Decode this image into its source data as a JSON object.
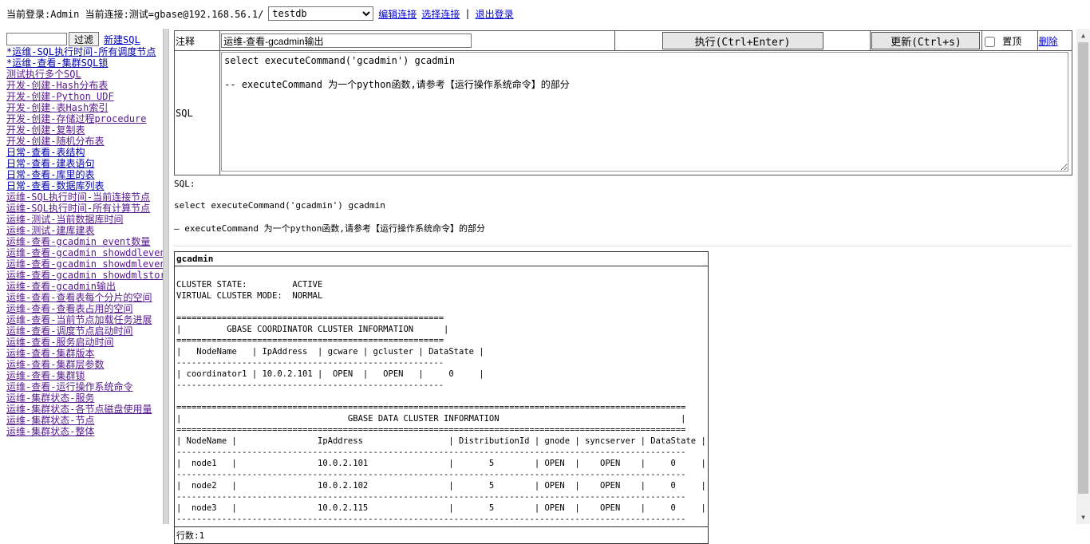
{
  "topbar": {
    "login_text": "当前登录:Admin 当前连接:测试=gbase@192.168.56.1/",
    "db_selected": "testdb",
    "edit_connection": "编辑连接",
    "select_connection": "选择连接",
    "separator": "|",
    "logout": "退出登录"
  },
  "sidebar": {
    "filter_button": "过滤",
    "new_sql": "新建SQL",
    "items": [
      {
        "label": "*运维-SQL执行时间-所有调度节点"
      },
      {
        "label": "*运维-查看-集群SQL锁"
      },
      {
        "label": "测试执行多个SQL"
      },
      {
        "label": "开发-创建-Hash分布表"
      },
      {
        "label": "开发-创建-Python UDF"
      },
      {
        "label": "开发-创建-表Hash索引"
      },
      {
        "label": "开发-创建-存储过程procedure"
      },
      {
        "label": "开发-创建-复制表"
      },
      {
        "label": "开发-创建-随机分布表"
      },
      {
        "label": "日常-查看-表结构"
      },
      {
        "label": "日常-查看-建表语句"
      },
      {
        "label": "日常-查看-库里的表"
      },
      {
        "label": "日常-查看-数据库列表"
      },
      {
        "label": "运维-SQL执行时间-当前连接节点"
      },
      {
        "label": "运维-SQL执行时间-所有计算节点"
      },
      {
        "label": "运维-测试-当前数据库时间"
      },
      {
        "label": "运维-测试-建库建表"
      },
      {
        "label": "运维-查看-gcadmin event数量"
      },
      {
        "label": "运维-查看-gcadmin showddlevent"
      },
      {
        "label": "运维-查看-gcadmin showdmlevent"
      },
      {
        "label": "运维-查看-gcadmin showdmlstorage"
      },
      {
        "label": "运维-查看-gcadmin输出"
      },
      {
        "label": "运维-查看-查看表每个分片的空间"
      },
      {
        "label": "运维-查看-查看表占用的空间"
      },
      {
        "label": "运维-查看-当前节点加载任务进展"
      },
      {
        "label": "运维-查看-调度节点启动时间"
      },
      {
        "label": "运维-查看-服务启动时间"
      },
      {
        "label": "运维-查看-集群版本"
      },
      {
        "label": "运维-查看-集群层参数"
      },
      {
        "label": "运维-查看-集群锁"
      },
      {
        "label": "运维-查看-运行操作系统命令"
      },
      {
        "label": "运维-集群状态-服务"
      },
      {
        "label": "运维-集群状态-各节点磁盘使用量"
      },
      {
        "label": "运维-集群状态-节点"
      },
      {
        "label": "运维-集群状态-整体"
      }
    ]
  },
  "editor": {
    "comment_label": "注释",
    "comment_value": "运维-查看-gcadmin输出",
    "execute_button": "执行(Ctrl+Enter)",
    "update_button": "更新(Ctrl+s)",
    "pin_label": "置顶",
    "delete_link": "删除",
    "sql_label": "SQL",
    "sql_value": "select executeCommand('gcadmin') gcadmin\n\n-- executeCommand 为一个python函数,请参考【运行操作系统命令】的部分"
  },
  "preview": {
    "label": "SQL:",
    "line1": "select executeCommand('gcadmin') gcadmin",
    "line2": "— executeCommand 为一个python函数,请参考【运行操作系统命令】的部分"
  },
  "result": {
    "column": "gcadmin",
    "output": "\nCLUSTER STATE:         ACTIVE\nVIRTUAL CLUSTER MODE:  NORMAL\n\n=====================================================\n|         GBASE COORDINATOR CLUSTER INFORMATION      |\n=====================================================\n|   NodeName   | IpAddress  | gcware | gcluster | DataState |\n-----------------------------------------------------\n| coordinator1 | 10.0.2.101 |  OPEN  |   OPEN   |     0     |\n-----------------------------------------------------\n\n=====================================================================================================\n|                                 GBASE DATA CLUSTER INFORMATION                                    |\n=====================================================================================================\n| NodeName |                IpAddress                 | DistributionId | gnode | syncserver | DataState |\n-----------------------------------------------------------------------------------------------------\n|  node1   |                10.0.2.101                |       5        | OPEN  |    OPEN    |     0     |\n-----------------------------------------------------------------------------------------------------\n|  node2   |                10.0.2.102                |       5        | OPEN  |    OPEN    |     0     |\n-----------------------------------------------------------------------------------------------------\n|  node3   |                10.0.2.115                |       5        | OPEN  |    OPEN    |     0     |\n-----------------------------------------------------------------------------------------------------\n",
    "row_count": "行数:1"
  }
}
